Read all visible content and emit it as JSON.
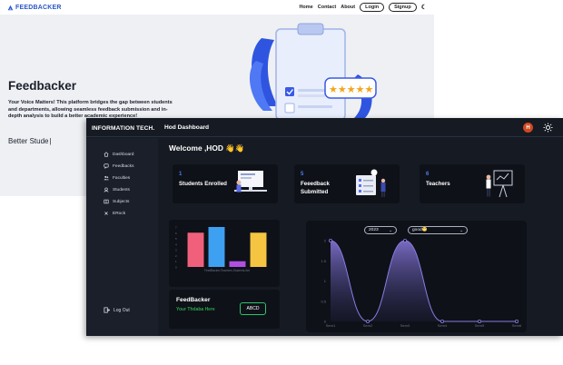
{
  "landing": {
    "brand": "FEEDBACKER",
    "nav": {
      "home": "Home",
      "contact": "Contact",
      "about": "About",
      "login": "Login",
      "signup": "Signup"
    },
    "hero_title": "Feedbacker",
    "hero_description": "Your Voice Matters! This platform bridges the gap between students and departments, allowing seamless feedback submission and in-depth analysis to build a better academic experience!",
    "typed_text": "Better Stude"
  },
  "dashboard": {
    "org": "INFORMATION TECH.",
    "title": "Hod Dashboard",
    "avatar_letter": "H",
    "welcome": "Welcome ,HOD 👋👋",
    "sidebar": [
      {
        "label": "Dashboard",
        "icon": "home-icon"
      },
      {
        "label": "Feedbacks",
        "icon": "chat-icon"
      },
      {
        "label": "Faculties",
        "icon": "people-icon"
      },
      {
        "label": "Students",
        "icon": "student-icon"
      },
      {
        "label": "Subjects",
        "icon": "book-icon"
      },
      {
        "label": "ERock",
        "icon": "close-icon"
      }
    ],
    "logout": "Log Out",
    "stats": [
      {
        "number": "1",
        "label": "Students Enrolled"
      },
      {
        "number": "5",
        "label": "Feeedback Submitted"
      },
      {
        "number": "6",
        "label": "Teachers"
      }
    ],
    "feedbacker_card": {
      "title": "FeedBacker",
      "tagline": "Your Thdaba Here",
      "button": "ABCD"
    },
    "filters": {
      "year": "2023",
      "rating": "good😁"
    }
  },
  "chart_data": [
    {
      "type": "bar",
      "categories": [
        "FeedBacker",
        "Teachers",
        "Students",
        "Ant"
      ],
      "values": [
        6,
        7,
        1,
        6
      ],
      "colors": [
        "#f0607a",
        "#3ea0f0",
        "#b050e0",
        "#f5c542"
      ],
      "xlabel": "FeedBacker,Teachers,Students,Ant",
      "ylim": [
        0,
        7
      ]
    },
    {
      "type": "area",
      "x": [
        "Sem1",
        "Sem2",
        "Sem3",
        "Sem4",
        "Sem5",
        "Sem6"
      ],
      "values": [
        2,
        0,
        2,
        0,
        0,
        0
      ],
      "yticks": [
        "0",
        "0.5",
        "1",
        "1.5",
        "2"
      ],
      "ylim": [
        0,
        2
      ],
      "color": "#8a7be0"
    }
  ]
}
